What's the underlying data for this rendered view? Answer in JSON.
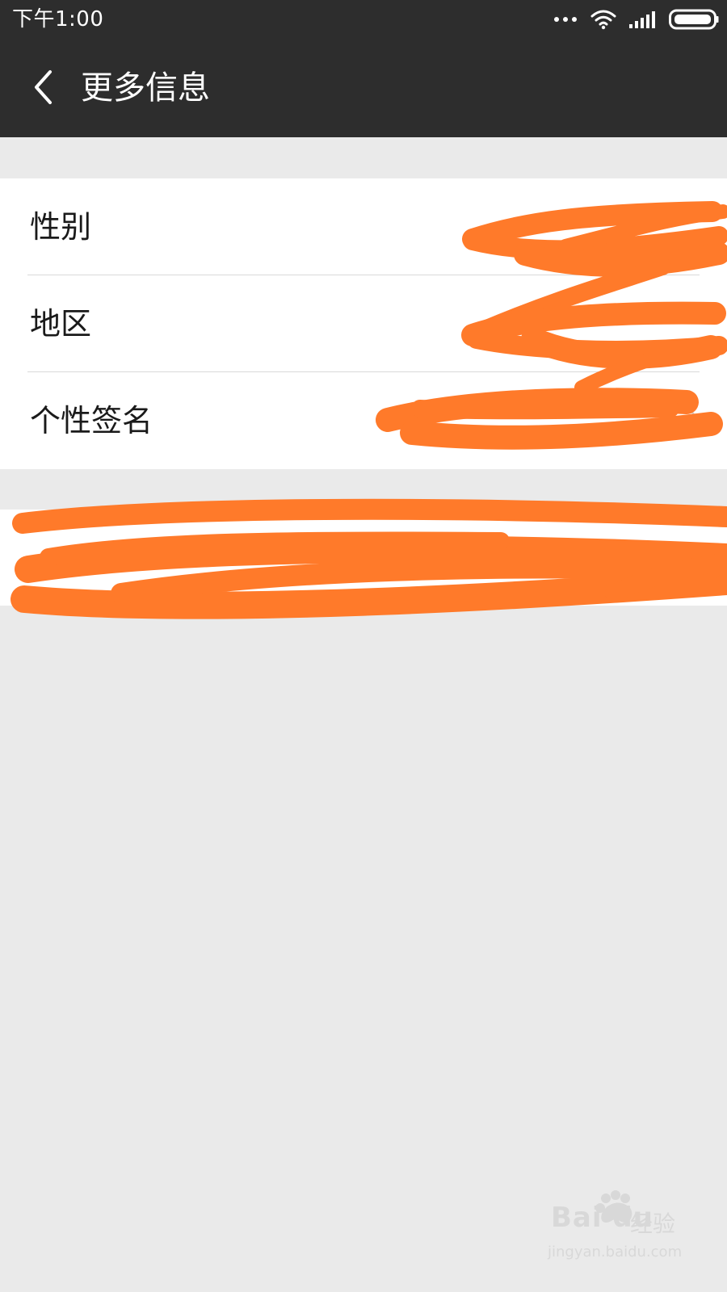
{
  "status_bar": {
    "time": "下午1:00",
    "icons": [
      "more-dots-icon",
      "wifi-icon",
      "signal-icon",
      "battery-icon"
    ]
  },
  "nav": {
    "title": "更多信息",
    "back_icon": "chevron-left-icon"
  },
  "info": {
    "rows": [
      {
        "label": "性别",
        "value_redacted": true
      },
      {
        "label": "地区",
        "value_redacted": true
      },
      {
        "label": "个性签名",
        "value_redacted": true
      }
    ]
  },
  "extra": {
    "label_redacted": true
  },
  "watermark": {
    "brand": "Bai du",
    "product": "经验",
    "url": "jingyan.baidu.com"
  },
  "colors": {
    "header_bg": "#2d2d2d",
    "page_bg": "#eaeaea",
    "card_bg": "#ffffff",
    "redaction": "#ff7a2a"
  }
}
